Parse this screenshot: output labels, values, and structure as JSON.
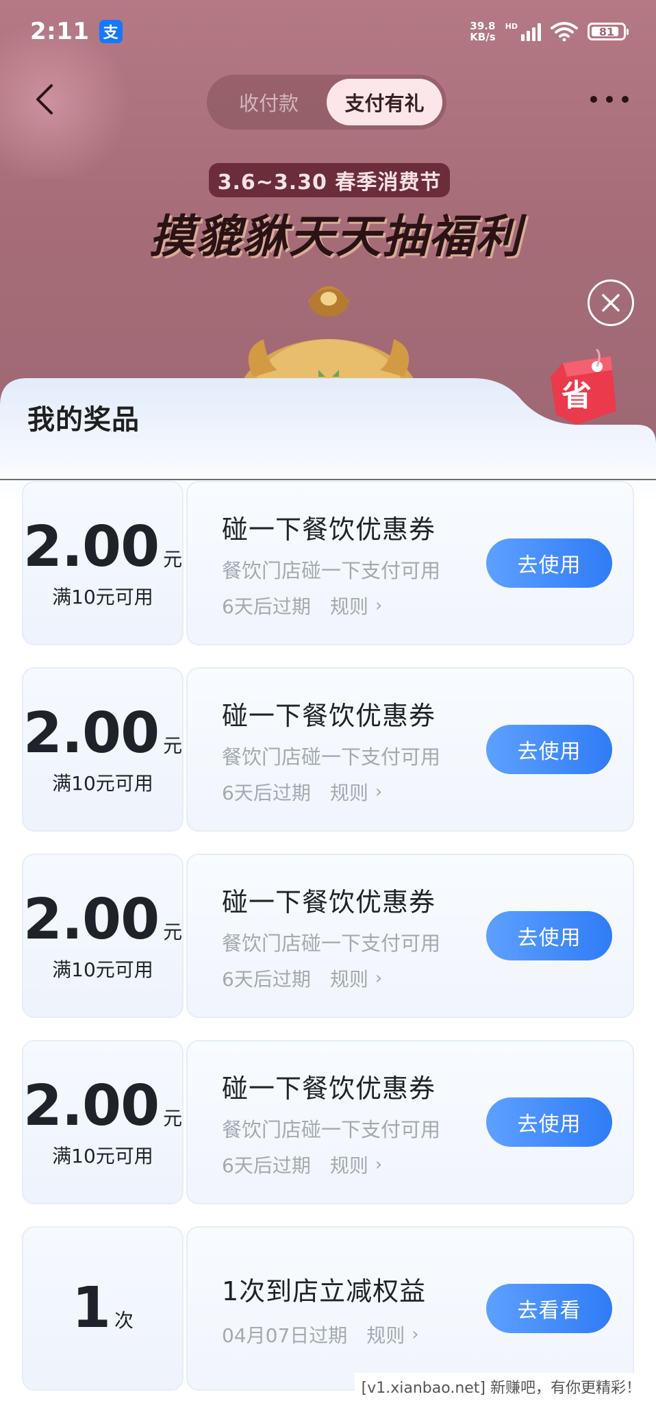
{
  "status_bar": {
    "time": "2:11",
    "app_badge": "支",
    "net_speed_value": "39.8",
    "net_speed_unit": "KB/s",
    "hd_label": "HD",
    "battery": "81"
  },
  "nav": {
    "tabs": [
      {
        "label": "收付款",
        "active": false
      },
      {
        "label": "支付有礼",
        "active": true
      }
    ]
  },
  "banner": {
    "date_range": "3.6~3.30 春季消费节",
    "slogan": "摸貔貅天天抽福利"
  },
  "sheet": {
    "title": "我的奖品",
    "tag_char": "省"
  },
  "coupons": [
    {
      "amount": "2.00",
      "unit": "元",
      "condition": "满10元可用",
      "title": "碰一下餐饮优惠券",
      "desc": "餐饮门店碰一下支付可用",
      "expiry": "6天后过期",
      "rule_label": "规则",
      "button": "去使用"
    },
    {
      "amount": "2.00",
      "unit": "元",
      "condition": "满10元可用",
      "title": "碰一下餐饮优惠券",
      "desc": "餐饮门店碰一下支付可用",
      "expiry": "6天后过期",
      "rule_label": "规则",
      "button": "去使用"
    },
    {
      "amount": "2.00",
      "unit": "元",
      "condition": "满10元可用",
      "title": "碰一下餐饮优惠券",
      "desc": "餐饮门店碰一下支付可用",
      "expiry": "6天后过期",
      "rule_label": "规则",
      "button": "去使用"
    },
    {
      "amount": "2.00",
      "unit": "元",
      "condition": "满10元可用",
      "title": "碰一下餐饮优惠券",
      "desc": "餐饮门店碰一下支付可用",
      "expiry": "6天后过期",
      "rule_label": "规则",
      "button": "去使用"
    }
  ],
  "benefit": {
    "count": "1",
    "unit": "次",
    "title": "1次到店立减权益",
    "expiry": "04月07日过期",
    "rule_label": "规则",
    "button": "去看看"
  },
  "watermark": "[v1.xianbao.net] 新赚吧，有你更精彩！",
  "colors": {
    "accent_blue": "#2f7cf6",
    "header_bg": "#a66d78",
    "tag_red": "#e8354a"
  }
}
